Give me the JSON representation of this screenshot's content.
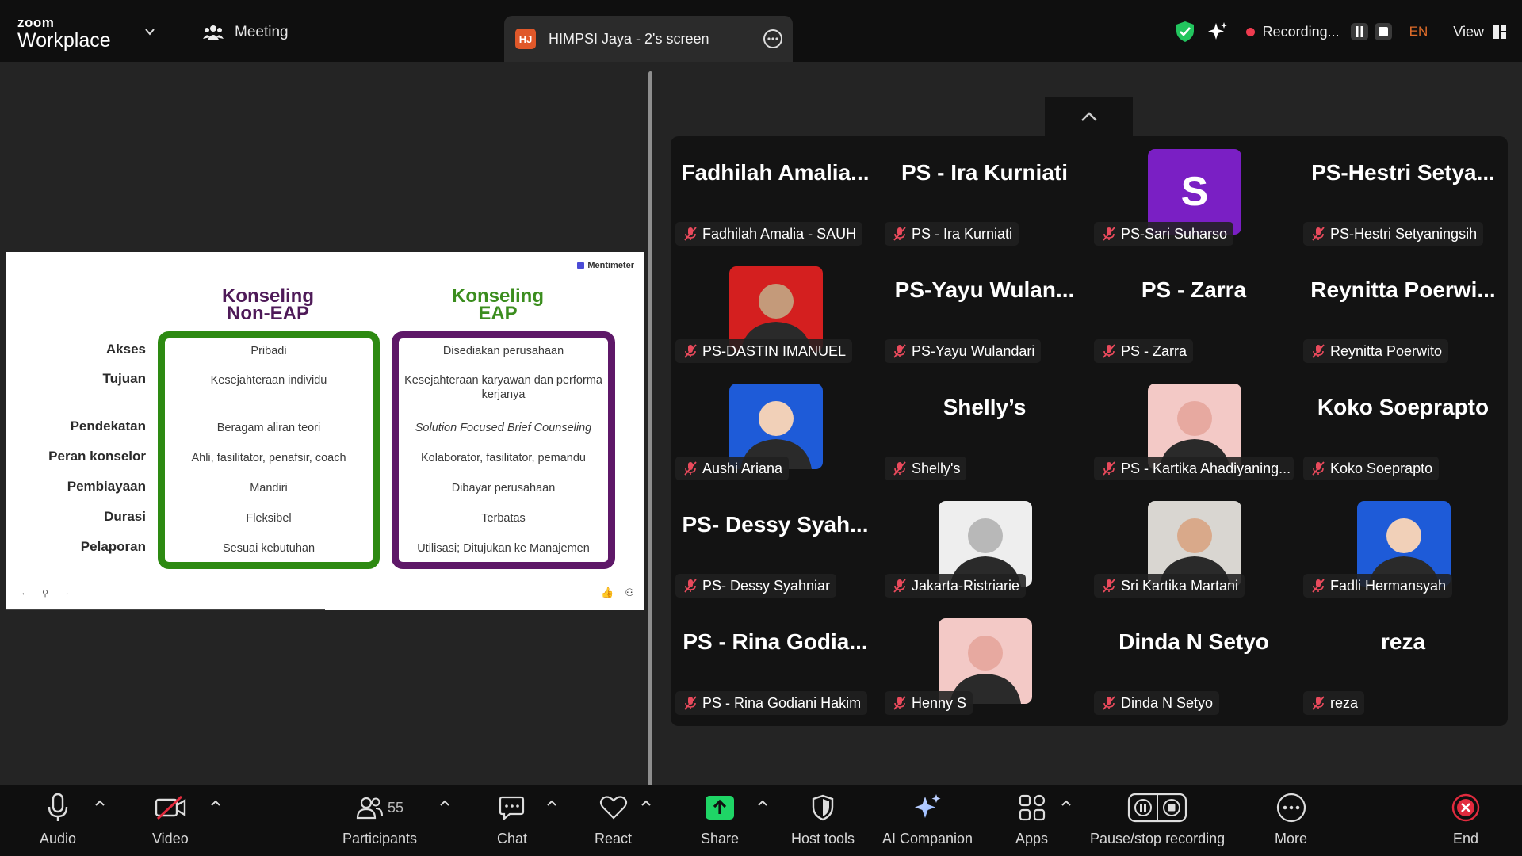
{
  "app": {
    "brand_top": "zoom",
    "brand_bottom": "Workplace"
  },
  "header": {
    "meeting_label": "Meeting",
    "screen_tab": {
      "badge": "HJ",
      "label": "HIMPSI Jaya - 2's screen"
    },
    "recording_label": "Recording...",
    "language": "EN",
    "view_label": "View"
  },
  "slide": {
    "brand": "Mentimeter",
    "col1_title": [
      "Konseling",
      "Non-EAP"
    ],
    "col2_title": [
      "Konseling",
      "EAP"
    ],
    "rows": [
      {
        "label": "Akses",
        "non_eap": "Pribadi",
        "eap": "Disediakan perusahaan"
      },
      {
        "label": "Tujuan",
        "non_eap": "Kesejahteraan individu",
        "eap": "Kesejahteraan karyawan dan performa kerjanya"
      },
      {
        "label": "Pendekatan",
        "non_eap": "Beragam aliran teori",
        "eap": "Solution Focused Brief Counseling"
      },
      {
        "label": "Peran konselor",
        "non_eap": "Ahli, fasilitator, penafsir, coach",
        "eap": "Kolaborator, fasilitator, pemandu"
      },
      {
        "label": "Pembiayaan",
        "non_eap": "Mandiri",
        "eap": "Dibayar perusahaan"
      },
      {
        "label": "Durasi",
        "non_eap": "Fleksibel",
        "eap": "Terbatas"
      },
      {
        "label": "Pelaporan",
        "non_eap": "Sesuai kebutuhan",
        "eap": "Utilisasi; Ditujukan ke Manajemen"
      }
    ]
  },
  "participants": [
    {
      "big": "Fadhilah  Amalia...",
      "name": "Fadhilah Amalia - SAUH"
    },
    {
      "big": "PS - Ira Kurniati",
      "name": "PS - Ira Kurniati"
    },
    {
      "big": "",
      "avatar": "S",
      "name": "PS-Sari Suharso"
    },
    {
      "big": "PS-Hestri  Setya...",
      "name": "PS-Hestri Setyaningsih"
    },
    {
      "big": "",
      "avatar": "photo",
      "name": "PS-DASTIN IMANUEL"
    },
    {
      "big": "PS-Yayu  Wulan...",
      "name": "PS-Yayu Wulandari"
    },
    {
      "big": "PS - Zarra",
      "name": "PS - Zarra"
    },
    {
      "big": "Reynitta  Poerwi...",
      "name": "Reynitta Poerwito"
    },
    {
      "big": "",
      "avatar": "photo",
      "name": "Aushi Ariana"
    },
    {
      "big": "Shelly’s",
      "name": "Shelly's"
    },
    {
      "big": "",
      "avatar": "photo",
      "name": "PS - Kartika Ahadiyaning..."
    },
    {
      "big": "Koko Soeprapto",
      "name": "Koko Soeprapto"
    },
    {
      "big": "PS-  Dessy  Syah...",
      "name": "PS- Dessy Syahniar"
    },
    {
      "big": "",
      "avatar": "photo",
      "name": "Jakarta-Ristriarie"
    },
    {
      "big": "",
      "avatar": "photo",
      "name": "Sri Kartika Martani"
    },
    {
      "big": "",
      "avatar": "photo",
      "name": "Fadli Hermansyah"
    },
    {
      "big": "PS  -  Rina  Godia...",
      "name": "PS - Rina Godiani Hakim"
    },
    {
      "big": "",
      "avatar": "photo",
      "name": "Henny S"
    },
    {
      "big": "Dinda N Setyo",
      "name": "Dinda N Setyo"
    },
    {
      "big": "reza",
      "name": "reza"
    }
  ],
  "toolbar": {
    "audio": "Audio",
    "video": "Video",
    "participants": "Participants",
    "participants_count": "55",
    "chat": "Chat",
    "react": "React",
    "share": "Share",
    "host_tools": "Host tools",
    "ai_companion": "AI Companion",
    "apps": "Apps",
    "pause_stop": "Pause/stop recording",
    "more": "More",
    "end": "End"
  },
  "colors": {
    "share_green": "#1fd566",
    "end_red": "#e22b3e",
    "tile_bg": "#131313",
    "purple_avatar": "#7a1fc4"
  }
}
